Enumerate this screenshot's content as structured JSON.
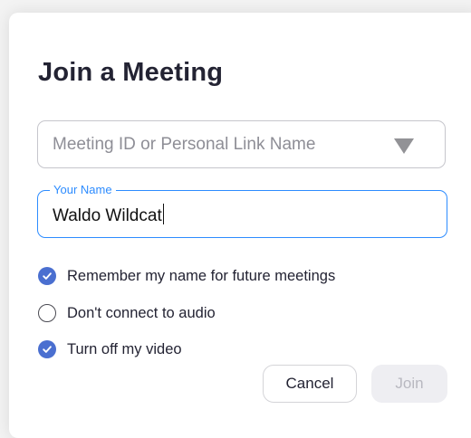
{
  "dialog": {
    "title": "Join a Meeting"
  },
  "meeting_id": {
    "placeholder": "Meeting ID or Personal Link Name",
    "value": ""
  },
  "your_name": {
    "label": "Your Name",
    "value": "Waldo Wildcat"
  },
  "options": [
    {
      "label": "Remember my name for future meetings",
      "checked": true
    },
    {
      "label": "Don't connect to audio",
      "checked": false
    },
    {
      "label": "Turn off my video",
      "checked": true
    }
  ],
  "buttons": {
    "cancel_label": "Cancel",
    "join_label": "Join",
    "join_enabled": false
  },
  "colors": {
    "accent": "#2d8cff",
    "checkbox_checked": "#4a6fd0",
    "title_text": "#232333"
  },
  "icons": {
    "dropdown": "triangle-down-icon",
    "check": "checkmark-icon"
  }
}
